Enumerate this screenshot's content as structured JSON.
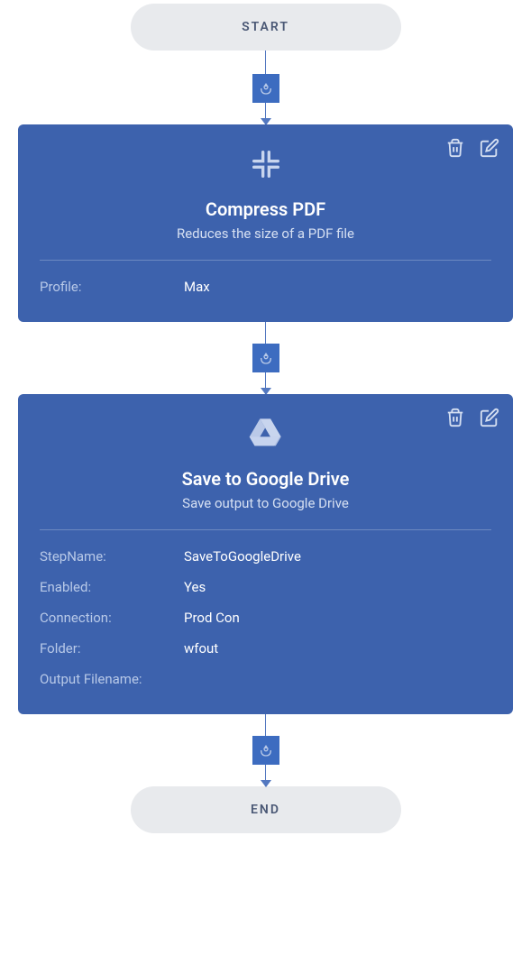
{
  "start_label": "START",
  "end_label": "END",
  "steps": [
    {
      "icon": "compress",
      "title": "Compress PDF",
      "subtitle": "Reduces the size of a PDF file",
      "props": [
        {
          "label": "Profile:",
          "value": "Max"
        }
      ]
    },
    {
      "icon": "google-drive",
      "title": "Save to Google Drive",
      "subtitle": "Save output to Google Drive",
      "props": [
        {
          "label": "StepName:",
          "value": "SaveToGoogleDrive"
        },
        {
          "label": "Enabled:",
          "value": "Yes"
        },
        {
          "label": "Connection:",
          "value": "Prod Con"
        },
        {
          "label": "Folder:",
          "value": "wfout"
        },
        {
          "label": "Output Filename:",
          "value": ""
        }
      ]
    }
  ]
}
